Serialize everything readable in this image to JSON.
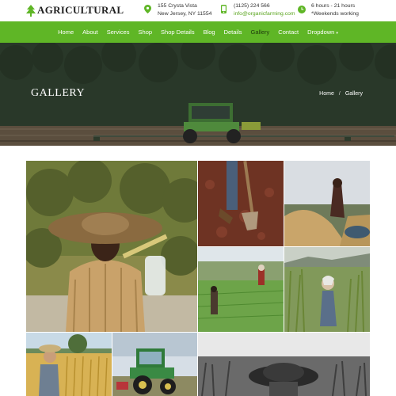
{
  "brand": {
    "name": "AGRICULTURAL",
    "icon": "tree-icon"
  },
  "contact": {
    "address": {
      "icon": "map-pin-icon",
      "line1": "155 Crysta Vista",
      "line2": "New Jersey, NY 11554"
    },
    "phone": {
      "icon": "phone-icon",
      "line1": "(1125) 224 566",
      "line2": "info@organicfarming.com"
    },
    "hours": {
      "icon": "clock-icon",
      "line1": "6 hours - 21 hours",
      "line2": "*Weekends working"
    }
  },
  "nav": {
    "items": [
      "Home",
      "About",
      "Services",
      "Shop",
      "Shop Details",
      "Blog",
      "Details",
      "Gallery",
      "Contact",
      "Dropdown"
    ],
    "active": "Gallery",
    "dropdown_caret": "▾"
  },
  "hero": {
    "title": "GALLERY"
  },
  "breadcrumb": {
    "home": "Home",
    "separator": "/",
    "current": "Gallery"
  },
  "colors": {
    "accent": "#5fb626",
    "nav_active": "#1f3d0d",
    "hero_overlay": "#2c3a2a"
  },
  "gallery": {
    "images": [
      "farmer-with-straw-hat-photo",
      "soil-and-shovel-photo",
      "woman-with-grain-pile-photo",
      "farmers-in-green-field-photo",
      "woman-in-tall-grass-photo",
      "farmer-in-wheat-field-photo",
      "green-tractor-photo",
      "farmer-with-hat-black-white-photo"
    ]
  }
}
